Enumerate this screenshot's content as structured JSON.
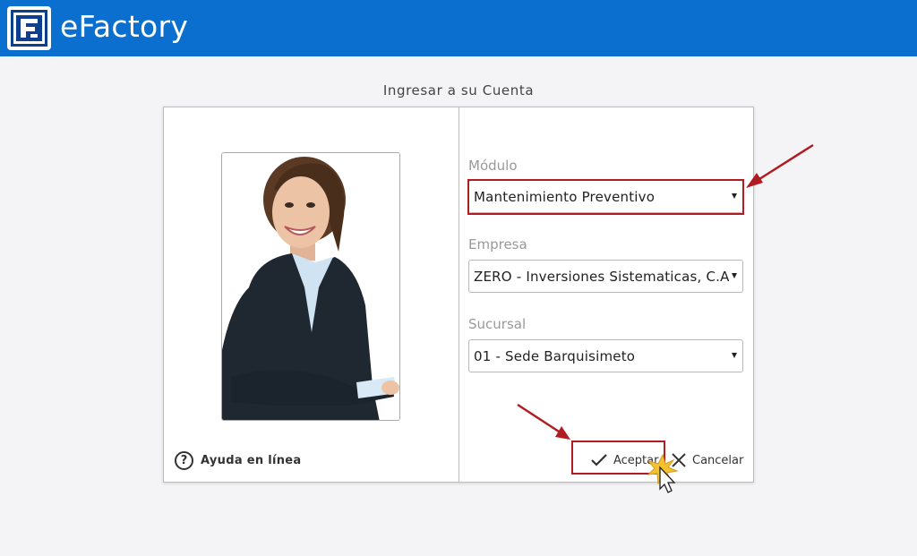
{
  "header": {
    "app_title": "eFactory",
    "logo_icon": "efactory-logo-icon",
    "brand_color": "#0a6fce"
  },
  "login": {
    "heading": "Ingresar a su Cuenta",
    "help_label": "Ayuda en línea",
    "photo": "woman-portrait-photo",
    "fields": {
      "modulo": {
        "label": "Módulo",
        "value": "Mantenimiento Preventivo"
      },
      "empresa": {
        "label": "Empresa",
        "value": "ZERO - Inversiones Sistematicas, C.A."
      },
      "sucursal": {
        "label": "Sucursal",
        "value": "01 - Sede Barquisimeto"
      }
    },
    "buttons": {
      "accept_label": "Aceptar",
      "cancel_label": "Cancelar"
    }
  },
  "annotations": {
    "highlight_color": "#b01c22"
  }
}
